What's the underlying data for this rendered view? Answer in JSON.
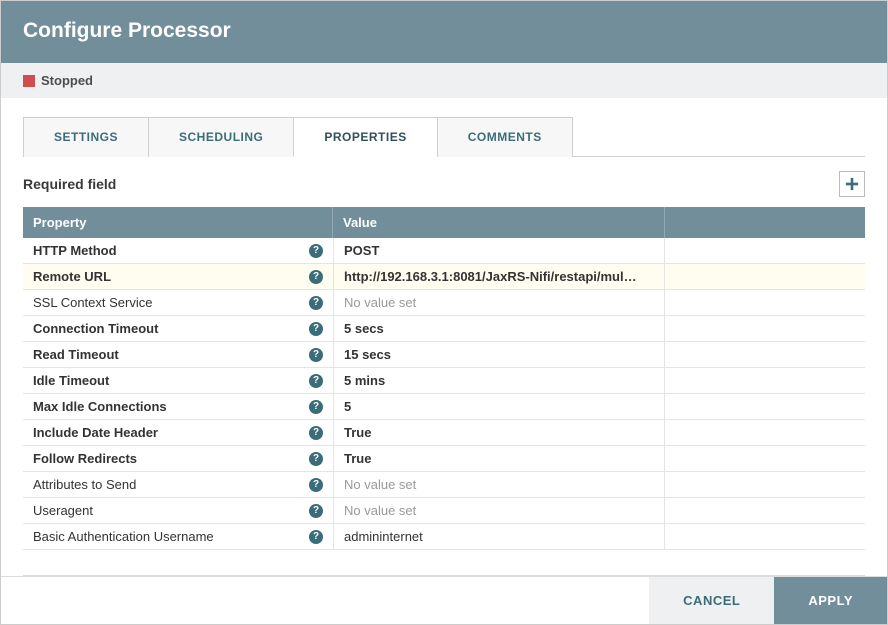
{
  "header": {
    "title": "Configure Processor"
  },
  "status": {
    "label": "Stopped",
    "color": "#cf4d4d"
  },
  "tabs": [
    {
      "label": "SETTINGS",
      "active": false
    },
    {
      "label": "SCHEDULING",
      "active": false
    },
    {
      "label": "PROPERTIES",
      "active": true
    },
    {
      "label": "COMMENTS",
      "active": false
    }
  ],
  "subhead": {
    "label": "Required field"
  },
  "columns": {
    "property": "Property",
    "value": "Value"
  },
  "properties": [
    {
      "name": "HTTP Method",
      "bold": true,
      "value": "POST",
      "value_bold": true,
      "muted": false,
      "highlight": false
    },
    {
      "name": "Remote URL",
      "bold": true,
      "value": "http://192.168.3.1:8081/JaxRS-Nifi/restapi/mul…",
      "value_bold": true,
      "muted": false,
      "highlight": true
    },
    {
      "name": "SSL Context Service",
      "bold": false,
      "value": "No value set",
      "value_bold": false,
      "muted": true,
      "highlight": false
    },
    {
      "name": "Connection Timeout",
      "bold": true,
      "value": "5 secs",
      "value_bold": true,
      "muted": false,
      "highlight": false
    },
    {
      "name": "Read Timeout",
      "bold": true,
      "value": "15 secs",
      "value_bold": true,
      "muted": false,
      "highlight": false
    },
    {
      "name": "Idle Timeout",
      "bold": true,
      "value": "5 mins",
      "value_bold": true,
      "muted": false,
      "highlight": false
    },
    {
      "name": "Max Idle Connections",
      "bold": true,
      "value": "5",
      "value_bold": true,
      "muted": false,
      "highlight": false
    },
    {
      "name": "Include Date Header",
      "bold": true,
      "value": "True",
      "value_bold": true,
      "muted": false,
      "highlight": false
    },
    {
      "name": "Follow Redirects",
      "bold": true,
      "value": "True",
      "value_bold": true,
      "muted": false,
      "highlight": false
    },
    {
      "name": "Attributes to Send",
      "bold": false,
      "value": "No value set",
      "value_bold": false,
      "muted": true,
      "highlight": false
    },
    {
      "name": "Useragent",
      "bold": false,
      "value": "No value set",
      "value_bold": false,
      "muted": true,
      "highlight": false
    },
    {
      "name": "Basic Authentication Username",
      "bold": false,
      "value": "admininternet",
      "value_bold": false,
      "muted": false,
      "highlight": false
    }
  ],
  "footer": {
    "cancel": "CANCEL",
    "apply": "APPLY"
  }
}
